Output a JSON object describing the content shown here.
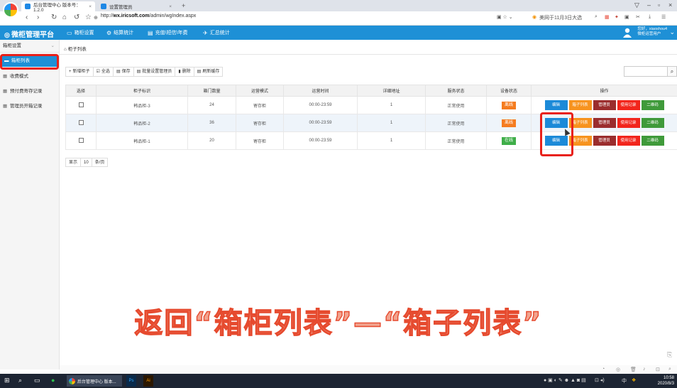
{
  "browser": {
    "tabs": [
      {
        "title": "后台管理中心 版本号：1.2.0",
        "close": "×"
      },
      {
        "title": "设置管理员",
        "close": "×"
      }
    ],
    "new_tab": "+",
    "url_prefix": "http://",
    "url_host": "wx.iricsoft.com",
    "url_path": "/admin/wgIndex.aspx",
    "search_hint": "美网于11月3日大选"
  },
  "app": {
    "title": "微柜管理平台",
    "nav": [
      {
        "icon": "monitor-icon",
        "label": "箱柜设置"
      },
      {
        "icon": "gear-icon",
        "label": "结算统计"
      },
      {
        "icon": "chart-icon",
        "label": "充值\\短信\\年费"
      },
      {
        "icon": "plane-icon",
        "label": "汇总统计"
      }
    ],
    "user_line1": "您好，xiaoshou4",
    "user_line2": "微柜运营用户"
  },
  "sidebar": {
    "header": "箱柜设置",
    "items": [
      {
        "label": "箱柜列表",
        "active": true
      },
      {
        "label": "收费模式"
      },
      {
        "label": "预付费寄存记录"
      },
      {
        "label": "管理员开箱记录"
      }
    ]
  },
  "breadcrumb": {
    "home_icon": "⌂",
    "label": "柜子列表"
  },
  "toolbar": {
    "buttons": [
      {
        "icon": "+",
        "label": "新增柜子"
      },
      {
        "icon": "☑",
        "label": "全选"
      },
      {
        "icon": "▤",
        "label": "保存"
      },
      {
        "icon": "▤",
        "label": "批量设置管理员"
      },
      {
        "icon": "▮",
        "label": "删除"
      },
      {
        "icon": "▤",
        "label": "刷新缓存"
      }
    ]
  },
  "table": {
    "headers": [
      "选择",
      "柜子标识",
      "箱门数量",
      "运营模式",
      "运营时间",
      "详细地址",
      "服务状态",
      "设备状态",
      "操作"
    ],
    "rows": [
      {
        "name": "韩品柜-3",
        "doors": "24",
        "mode": "寄存柜",
        "time": "00:00-23:59",
        "addr": "1",
        "service": "正常使用",
        "device": "离线",
        "device_color": "#f57c1f"
      },
      {
        "name": "韩品柜-2",
        "doors": "36",
        "mode": "寄存柜",
        "time": "00:00-23:59",
        "addr": "1",
        "service": "正常使用",
        "device": "离线",
        "device_color": "#f57c1f"
      },
      {
        "name": "韩品柜-1",
        "doors": "20",
        "mode": "寄存柜",
        "time": "00:00-23:59",
        "addr": "1",
        "service": "正常使用",
        "device": "在线",
        "device_color": "#3fae49"
      }
    ],
    "ops": {
      "edit": "编辑",
      "boxes": "箱子列表",
      "admin": "管理员",
      "records": "使用记录",
      "qr": "二维码"
    }
  },
  "pager": {
    "show": "显示",
    "size": "10",
    "unit": "条/页"
  },
  "caption": "返回“箱柜列表”—“箱子列表”",
  "taskbar": {
    "apps": [
      {
        "label": "后台管理中心 版本..."
      },
      {
        "label": "Ps"
      },
      {
        "label": "Ai"
      }
    ],
    "time": "10:58",
    "date": "2020/8/3",
    "ime": "中"
  }
}
